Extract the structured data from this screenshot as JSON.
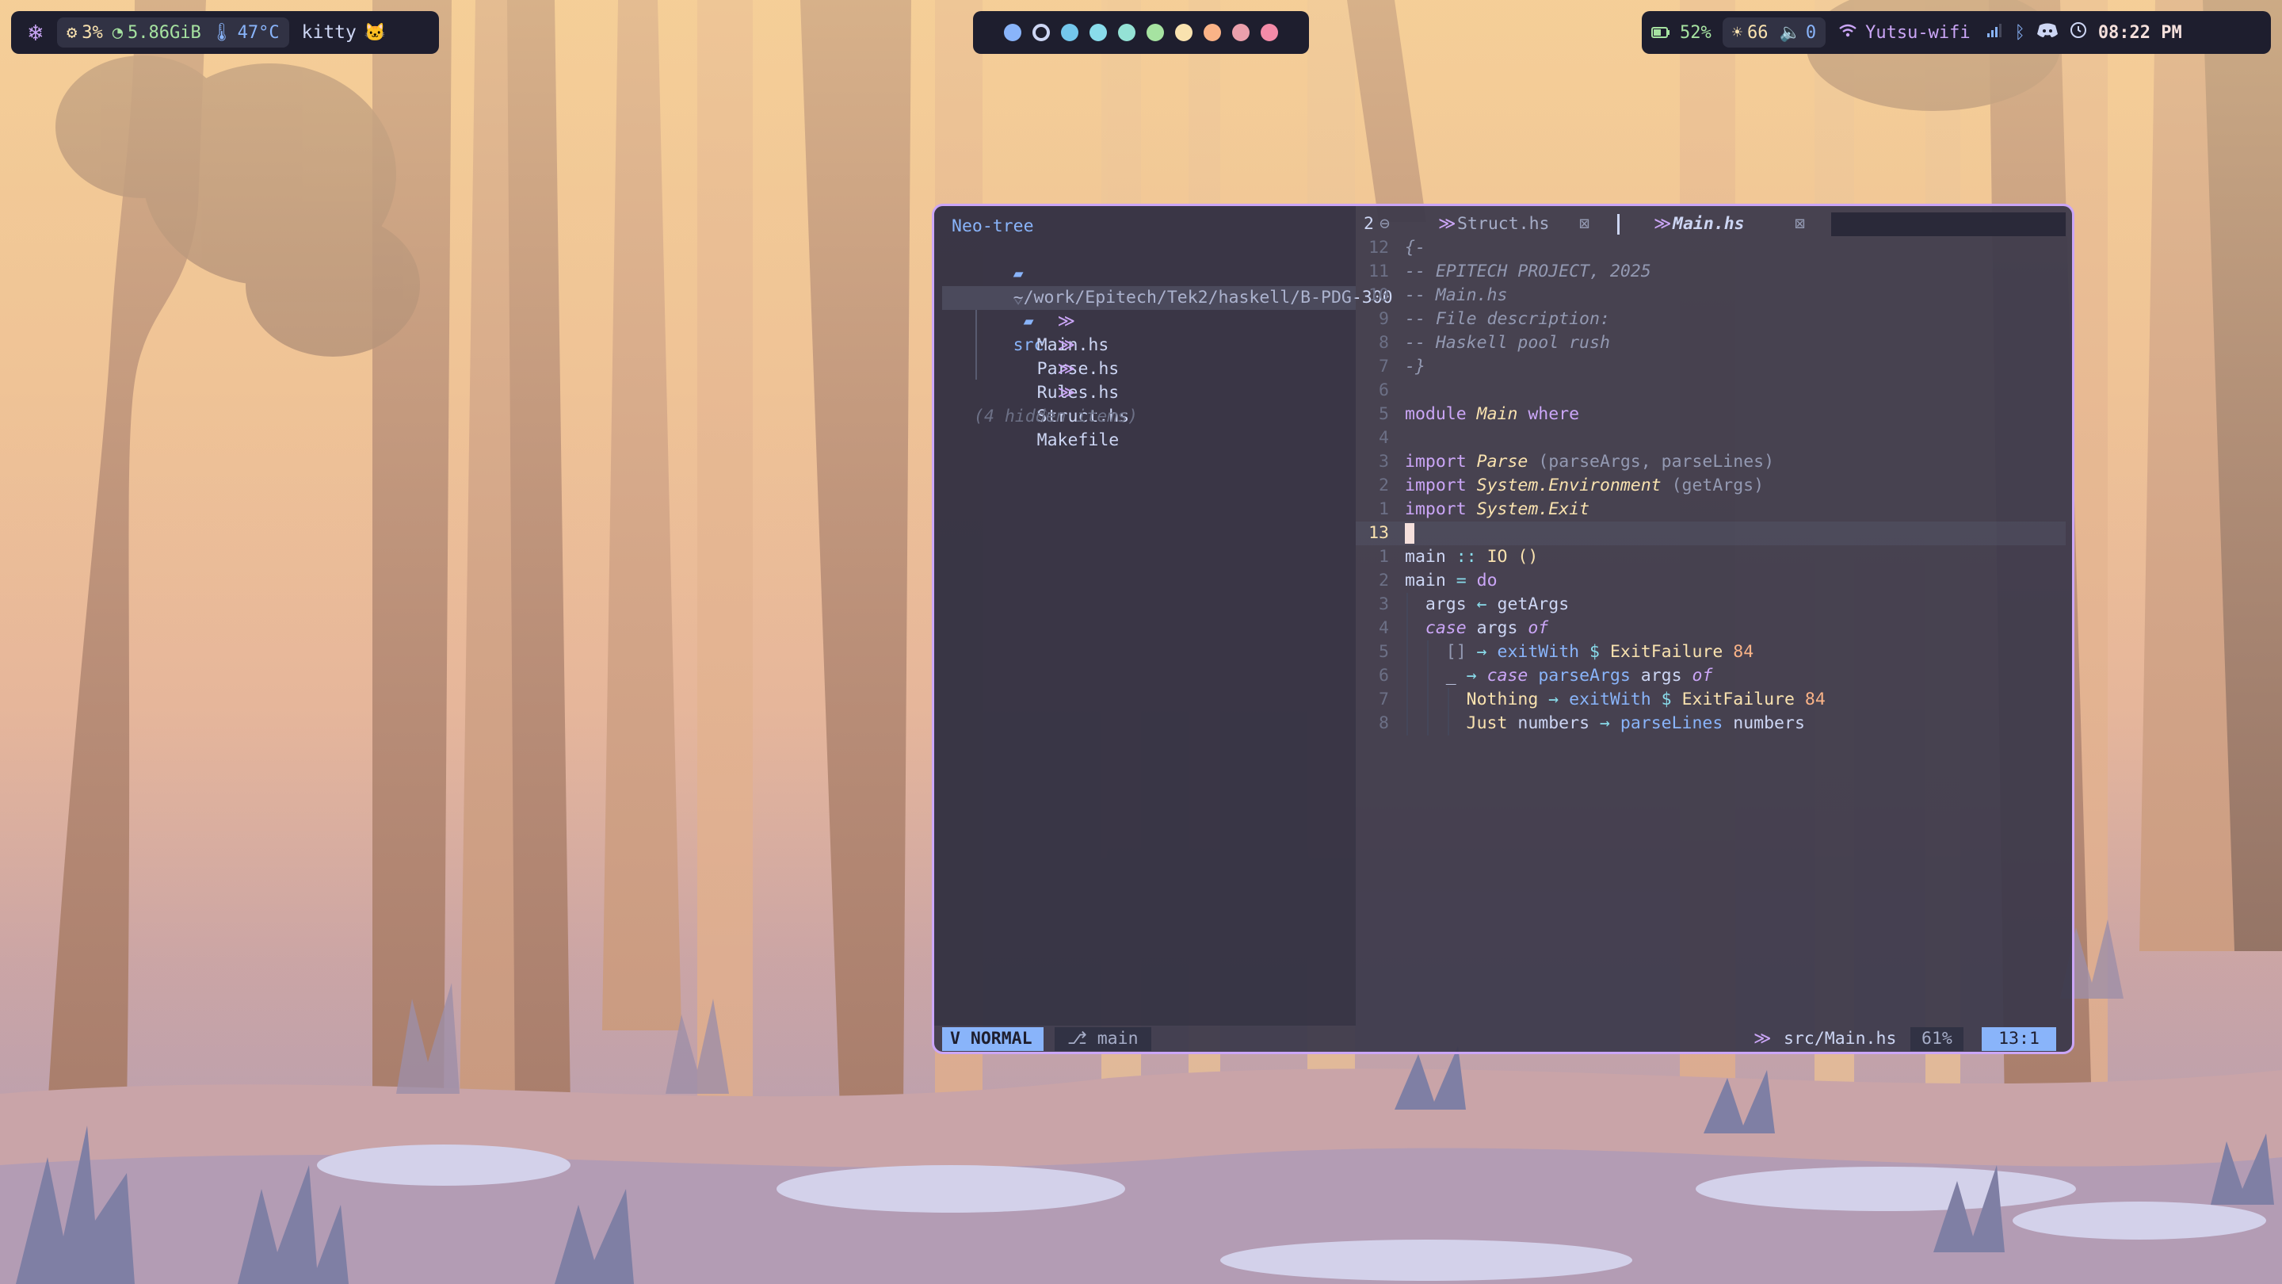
{
  "colors": {
    "bar_bg": "#1e1e2e",
    "accent": "#cba6f7",
    "mode_bg": "#89b4fa",
    "cursor": "#f5e0dc"
  },
  "topbar": {
    "left": {
      "logo_icon": "nixos-snowflake-icon",
      "cpu": "3%",
      "memory": "5.86GiB",
      "temperature": "47°C",
      "active_app": "kitty",
      "app_icon": "cat-icon"
    },
    "workspaces": [
      {
        "color": "#89b4fa",
        "active": false
      },
      {
        "color": "#cdd6f4",
        "active": true
      },
      {
        "color": "#74c7ec",
        "active": false
      },
      {
        "color": "#89dceb",
        "active": false
      },
      {
        "color": "#94e2d5",
        "active": false
      },
      {
        "color": "#a6e3a1",
        "active": false
      },
      {
        "color": "#f9e2af",
        "active": false
      },
      {
        "color": "#fab387",
        "active": false
      },
      {
        "color": "#eba0ac",
        "active": false
      },
      {
        "color": "#f38ba8",
        "active": false
      }
    ],
    "right": {
      "battery": "52%",
      "brightness": "66",
      "volume": "0",
      "wifi": "Yutsu-wifi",
      "time": "08:22 PM"
    }
  },
  "neotree": {
    "title": "Neo-tree",
    "root": "~/work/Epitech/Tek2/haskell/B-PDG-300",
    "folder": "src",
    "files": [
      "Main.hs",
      "Parse.hs",
      "Rules.hs",
      "Struct.hs"
    ],
    "makefile": "Makefile",
    "hidden": "(4 hidden items)"
  },
  "tabline": {
    "buffer_count": "2",
    "tabs": [
      {
        "label": "Struct.hs",
        "active": false
      },
      {
        "label": "Main.hs",
        "active": true
      }
    ]
  },
  "editor": {
    "current_line": "13",
    "relative_numbers_above": [
      "12",
      "11",
      "10",
      "9",
      "8",
      "7",
      "6",
      "5",
      "4",
      "3",
      "2",
      "1"
    ],
    "relative_numbers_below": [
      "1",
      "2",
      "3",
      "4",
      "5",
      "6",
      "7",
      "8"
    ],
    "comment_lines": [
      "{-",
      "-- EPITECH PROJECT, 2025",
      "-- Main.hs",
      "-- File description:",
      "-- Haskell pool rush",
      "-}"
    ],
    "module_line": {
      "kw1": "module",
      "name": "Main",
      "kw2": "where"
    },
    "imports": [
      {
        "kw": "import",
        "module": "Parse",
        "list": "(parseArgs, parseLines)"
      },
      {
        "kw": "import",
        "module": "System.Environment",
        "list": "(getArgs)"
      },
      {
        "kw": "import",
        "module": "System.Exit",
        "list": ""
      }
    ],
    "main_sig": {
      "name": "main",
      "sep": "::",
      "type": "IO ()"
    },
    "main_def": {
      "name": "main",
      "eq": "=",
      "kw": "do"
    },
    "body": {
      "args_var": "args",
      "arrow_left": "←",
      "getargs": "getArgs",
      "case_kw": "case",
      "of_kw": "of",
      "empty_list": "[]",
      "arrow_right": "→",
      "exitwith": "exitWith",
      "dollar": "$",
      "exitfailure": "ExitFailure",
      "code": "84",
      "wildcard": "_",
      "parseargs": "parseArgs",
      "nothing": "Nothing",
      "just": "Just",
      "numbers": "numbers",
      "parselines": "parseLines"
    }
  },
  "statusline": {
    "mode": "NORMAL",
    "branch": "main",
    "file": "src/Main.hs",
    "percent": "61%",
    "position": "13:1"
  }
}
